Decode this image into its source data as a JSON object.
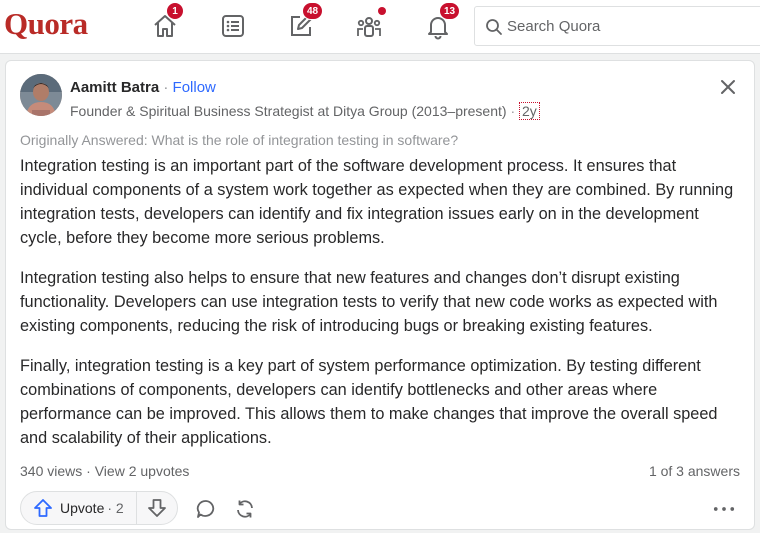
{
  "header": {
    "logo": "Quora",
    "nav": {
      "home_badge": "1",
      "following_badge": "",
      "answer_badge": "48",
      "spaces_dot": true,
      "notifications_badge": "13"
    },
    "search": {
      "placeholder": "Search Quora"
    }
  },
  "answer": {
    "author": "Aamitt Batra",
    "dot_sep": "·",
    "follow": "Follow",
    "credential": "Founder & Spiritual Business Strategist at Ditya Group (2013–present)",
    "age": "2y",
    "originally_answered": "Originally Answered: What is the role of integration testing in software?",
    "paragraphs": [
      "Integration testing is an important part of the software development process. It ensures that individual components of a system work together as expected when they are combined. By running integration tests, developers can identify and fix integration issues early on in the development cycle, before they become more serious problems.",
      "Integration testing also helps to ensure that new features and changes don’t disrupt existing functionality. Developers can use integration tests to verify that new code works as expected with existing components, reducing the risk of introducing bugs or breaking existing features.",
      "Finally, integration testing is a key part of system performance optimization. By testing different combinations of components, developers can identify bottlenecks and other areas where performance can be improved. This allows them to make changes that improve the overall speed and scalability of their applications."
    ],
    "views": "340 views",
    "view_upvotes": "View 2 upvotes",
    "answer_position": "1 of 3 answers",
    "upvote_label": "Upvote",
    "upvote_count": "· 2"
  },
  "colors": {
    "brand": "#b92b27",
    "link": "#2e69ff",
    "badge": "#c8102e"
  }
}
